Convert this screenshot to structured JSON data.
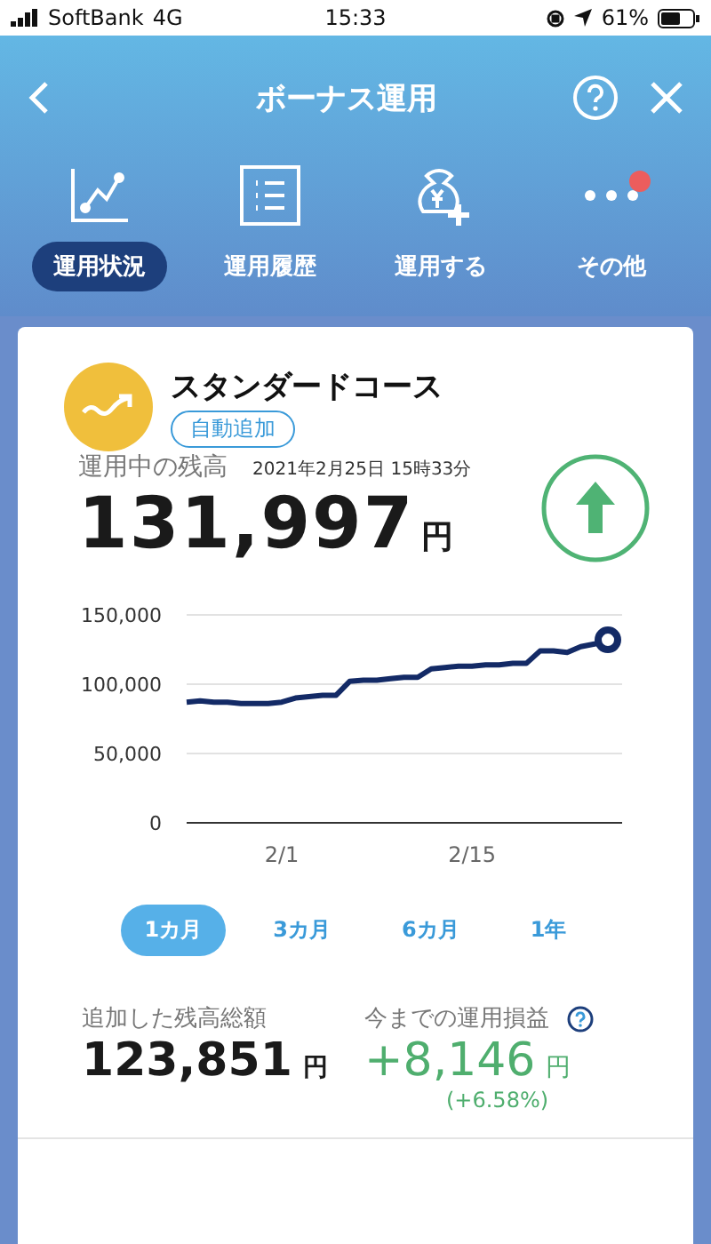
{
  "status_bar": {
    "carrier": "SoftBank",
    "network": "4G",
    "time": "15:33",
    "battery": "61%"
  },
  "header": {
    "title": "ボーナス運用"
  },
  "nav": [
    {
      "kind": "chart",
      "label": "運用状況",
      "selected": true,
      "badge": false
    },
    {
      "kind": "list",
      "label": "運用履歴",
      "selected": false,
      "badge": false
    },
    {
      "kind": "bag",
      "label": "運用する",
      "selected": false,
      "badge": false
    },
    {
      "kind": "more",
      "label": "その他",
      "selected": false,
      "badge": true
    }
  ],
  "course": {
    "name": "スタンダードコース",
    "tag": "自動追加",
    "balance_label": "運用中の残高",
    "timestamp": "2021年2月25日 15時33分",
    "balance": "131,997",
    "currency": "円"
  },
  "chart_data": {
    "type": "line",
    "categories": [
      null,
      null,
      null,
      null,
      null,
      null,
      null,
      "2/1",
      null,
      null,
      null,
      null,
      null,
      null,
      null,
      null,
      null,
      null,
      null,
      null,
      null,
      "2/15",
      null,
      null,
      null,
      null,
      null,
      null,
      null,
      null,
      null,
      null
    ],
    "series": [
      {
        "color": "#132a66",
        "values": [
          87000,
          88000,
          87000,
          87000,
          86000,
          86000,
          86000,
          87000,
          90000,
          91000,
          92000,
          92000,
          102000,
          103000,
          103000,
          104000,
          105000,
          105000,
          111000,
          112000,
          113000,
          113000,
          114000,
          114000,
          115000,
          115000,
          124000,
          124000,
          123000,
          127000,
          129000,
          132000
        ]
      }
    ],
    "ylim": [
      0,
      150000
    ],
    "yticks": [
      {
        "value": 0,
        "label": "0"
      },
      {
        "value": 50000,
        "label": "50,000"
      },
      {
        "value": 100000,
        "label": "100,000"
      },
      {
        "value": 150000,
        "label": "150,000"
      }
    ]
  },
  "periods": [
    {
      "label": "1カ月",
      "selected": true
    },
    {
      "label": "3カ月",
      "selected": false
    },
    {
      "label": "6カ月",
      "selected": false
    },
    {
      "label": "1年",
      "selected": false
    }
  ],
  "summary": {
    "added_label": "追加した残高総額",
    "added": "123,851",
    "added_currency": "円",
    "profit_label": "今までの運用損益",
    "profit": "+8,146",
    "profit_currency": "円",
    "profit_percent": "(+6.58%)"
  }
}
